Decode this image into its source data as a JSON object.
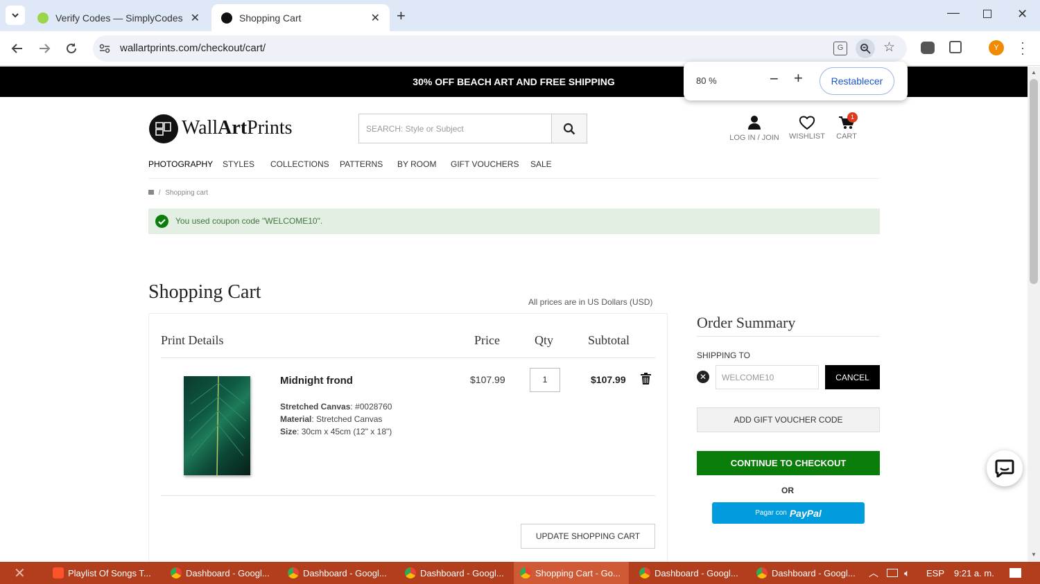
{
  "browser": {
    "tabs": [
      {
        "title": "Verify Codes — SimplyCodes",
        "active": false
      },
      {
        "title": "Shopping Cart",
        "active": true
      }
    ],
    "url": "wallartprints.com/checkout/cart/",
    "profile_initial": "Y",
    "zoom": {
      "level": "80 %",
      "reset_label": "Restablecer"
    }
  },
  "site": {
    "promo": "30% OFF BEACH ART AND FREE SHIPPING",
    "logo": {
      "part1": "Wall",
      "part2": "Art",
      "part3": "Prints"
    },
    "search_placeholder": "SEARCH: Style or Subject",
    "header_links": {
      "login": "LOG IN / JOIN",
      "wishlist": "WISHLIST",
      "cart": "CART",
      "cart_count": "1"
    },
    "nav": [
      "PHOTOGRAPHY",
      "STYLES",
      "COLLECTIONS",
      "PATTERNS",
      "BY ROOM",
      "GIFT VOUCHERS",
      "SALE"
    ],
    "breadcrumb": {
      "sep": "/",
      "current": "Shopping cart"
    },
    "coupon_message": "You used coupon code \"WELCOME10\"."
  },
  "cart": {
    "title": "Shopping Cart",
    "currency_note": "All prices are in US Dollars (USD)",
    "headers": {
      "details": "Print Details",
      "price": "Price",
      "qty": "Qty",
      "subtotal": "Subtotal"
    },
    "item": {
      "name": "Midnight frond",
      "attrs": [
        {
          "label": "Stretched Canvas",
          "value": "#0028760"
        },
        {
          "label": "Material",
          "value": "Stretched Canvas"
        },
        {
          "label": "Size",
          "value": "30cm x 45cm (12\" x 18\")"
        }
      ],
      "price": "$107.99",
      "qty": "1",
      "subtotal": "$107.99"
    },
    "update_label": "UPDATE SHOPPING CART"
  },
  "summary": {
    "title": "Order Summary",
    "shipping_label": "SHIPPING TO",
    "coupon_value": "WELCOME10",
    "cancel_label": "CANCEL",
    "gift_label": "ADD GIFT VOUCHER CODE",
    "checkout_label": "CONTINUE TO CHECKOUT",
    "or_label": "OR",
    "paypal_prefix": "Pagar con",
    "paypal_brand": "PayPal"
  },
  "taskbar": {
    "items": [
      "Playlist Of Songs T...",
      "Dashboard - Googl...",
      "Dashboard - Googl...",
      "Dashboard - Googl...",
      "Shopping Cart - Go...",
      "Dashboard - Googl...",
      "Dashboard - Googl..."
    ],
    "lang": "ESP",
    "time": "9:21 a. m."
  },
  "colors": {
    "checkout_green": "#0a7d0a",
    "paypal_blue": "#009cde",
    "taskbar": "#b23e1e",
    "coupon_bg": "#e3efe2"
  }
}
